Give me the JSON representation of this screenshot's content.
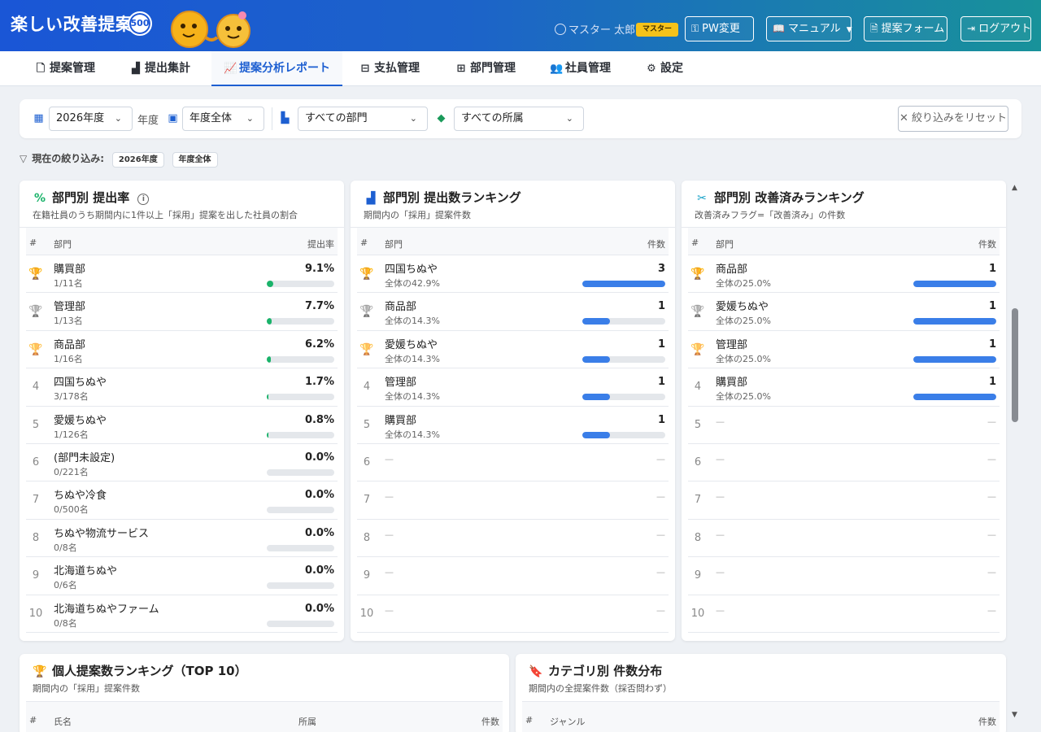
{
  "header": {
    "app_title": "楽しい改善提案",
    "badge": "500",
    "user_name": "マスター 太郎",
    "role": "マスター",
    "buttons": {
      "pw": "PW変更",
      "manual": "マニュアル",
      "form": "提案フォーム",
      "logout": "ログアウト"
    }
  },
  "nav": {
    "tabs": [
      {
        "label": "提案管理",
        "icon": "document-icon"
      },
      {
        "label": "提出集計",
        "icon": "bar-chart-icon"
      },
      {
        "label": "提案分析レポート",
        "icon": "line-chart-icon",
        "active": true
      },
      {
        "label": "支払管理",
        "icon": "payment-icon"
      },
      {
        "label": "部門管理",
        "icon": "org-chart-icon"
      },
      {
        "label": "社員管理",
        "icon": "users-icon"
      },
      {
        "label": "設定",
        "icon": "gear-icon"
      }
    ]
  },
  "filters": {
    "fiscal_year": "2026年度",
    "fiscal_year_label": "年度",
    "period": "年度全体",
    "department": "すべての部門",
    "affiliation": "すべての所属",
    "reset_label": "絞り込みをリセット",
    "current_label": "現在の絞り込み:",
    "chips": [
      "2026年度",
      "年度全体"
    ]
  },
  "colors": {
    "header_gradient_start": "#1a56d6",
    "header_gradient_end": "#18929a",
    "accent_blue": "#3a7ee8",
    "accent_green": "#1ab36a",
    "role_badge": "#f6c21a",
    "gold": "#f0a800",
    "silver": "#6e7681",
    "bronze": "#b5651d"
  },
  "cards": {
    "rate": {
      "title": "部門別 提出率",
      "subtitle": "在籍社員のうち期間内に1件以上「採用」提案を出した社員の割合",
      "col_rank": "#",
      "col_name": "部門",
      "col_value": "提出率",
      "rows": [
        {
          "rank": "1",
          "name": "購買部",
          "sub": "1/11名",
          "value": "9.1%",
          "ratio": 0.091
        },
        {
          "rank": "2",
          "name": "管理部",
          "sub": "1/13名",
          "value": "7.7%",
          "ratio": 0.077
        },
        {
          "rank": "3",
          "name": "商品部",
          "sub": "1/16名",
          "value": "6.2%",
          "ratio": 0.062
        },
        {
          "rank": "4",
          "name": "四国ちぬや",
          "sub": "3/178名",
          "value": "1.7%",
          "ratio": 0.017
        },
        {
          "rank": "5",
          "name": "愛媛ちぬや",
          "sub": "1/126名",
          "value": "0.8%",
          "ratio": 0.008
        },
        {
          "rank": "6",
          "name": "(部門未設定)",
          "sub": "0/221名",
          "value": "0.0%",
          "ratio": 0
        },
        {
          "rank": "7",
          "name": "ちぬや冷食",
          "sub": "0/500名",
          "value": "0.0%",
          "ratio": 0
        },
        {
          "rank": "8",
          "name": "ちぬや物流サービス",
          "sub": "0/8名",
          "value": "0.0%",
          "ratio": 0
        },
        {
          "rank": "9",
          "name": "北海道ちぬや",
          "sub": "0/6名",
          "value": "0.0%",
          "ratio": 0
        },
        {
          "rank": "10",
          "name": "北海道ちぬやファーム",
          "sub": "0/8名",
          "value": "0.0%",
          "ratio": 0
        }
      ]
    },
    "count": {
      "title": "部門別 提出数ランキング",
      "subtitle": "期間内の「採用」提案件数",
      "col_rank": "#",
      "col_name": "部門",
      "col_value": "件数",
      "rows": [
        {
          "rank": "1",
          "name": "四国ちぬや",
          "sub": "全体の42.9%",
          "value": "3",
          "ratio": 1.0
        },
        {
          "rank": "2",
          "name": "商品部",
          "sub": "全体の14.3%",
          "value": "1",
          "ratio": 0.333
        },
        {
          "rank": "3",
          "name": "愛媛ちぬや",
          "sub": "全体の14.3%",
          "value": "1",
          "ratio": 0.333
        },
        {
          "rank": "4",
          "name": "管理部",
          "sub": "全体の14.3%",
          "value": "1",
          "ratio": 0.333
        },
        {
          "rank": "5",
          "name": "購買部",
          "sub": "全体の14.3%",
          "value": "1",
          "ratio": 0.333
        },
        {
          "rank": "6",
          "name": "—",
          "sub": "",
          "value": "—",
          "ratio": null
        },
        {
          "rank": "7",
          "name": "—",
          "sub": "",
          "value": "—",
          "ratio": null
        },
        {
          "rank": "8",
          "name": "—",
          "sub": "",
          "value": "—",
          "ratio": null
        },
        {
          "rank": "9",
          "name": "—",
          "sub": "",
          "value": "—",
          "ratio": null
        },
        {
          "rank": "10",
          "name": "—",
          "sub": "",
          "value": "—",
          "ratio": null
        }
      ]
    },
    "improved": {
      "title": "部門別 改善済みランキング",
      "subtitle": "改善済みフラグ=「改善済み」の件数",
      "col_rank": "#",
      "col_name": "部門",
      "col_value": "件数",
      "rows": [
        {
          "rank": "1",
          "name": "商品部",
          "sub": "全体の25.0%",
          "value": "1",
          "ratio": 1.0
        },
        {
          "rank": "2",
          "name": "愛媛ちぬや",
          "sub": "全体の25.0%",
          "value": "1",
          "ratio": 1.0
        },
        {
          "rank": "3",
          "name": "管理部",
          "sub": "全体の25.0%",
          "value": "1",
          "ratio": 1.0
        },
        {
          "rank": "4",
          "name": "購買部",
          "sub": "全体の25.0%",
          "value": "1",
          "ratio": 1.0
        },
        {
          "rank": "5",
          "name": "—",
          "sub": "",
          "value": "—",
          "ratio": null
        },
        {
          "rank": "6",
          "name": "—",
          "sub": "",
          "value": "—",
          "ratio": null
        },
        {
          "rank": "7",
          "name": "—",
          "sub": "",
          "value": "—",
          "ratio": null
        },
        {
          "rank": "8",
          "name": "—",
          "sub": "",
          "value": "—",
          "ratio": null
        },
        {
          "rank": "9",
          "name": "—",
          "sub": "",
          "value": "—",
          "ratio": null
        },
        {
          "rank": "10",
          "name": "—",
          "sub": "",
          "value": "—",
          "ratio": null
        }
      ]
    },
    "personal": {
      "title": "個人提案数ランキング（TOP 10）",
      "subtitle": "期間内の「採用」提案件数",
      "col_rank": "#",
      "col_name": "氏名",
      "col_affiliation": "所属",
      "col_value": "件数"
    },
    "category": {
      "title": "カテゴリ別 件数分布",
      "subtitle": "期間内の全提案件数（採否問わず）",
      "col_rank": "#",
      "col_name": "ジャンル",
      "col_value": "件数"
    }
  }
}
